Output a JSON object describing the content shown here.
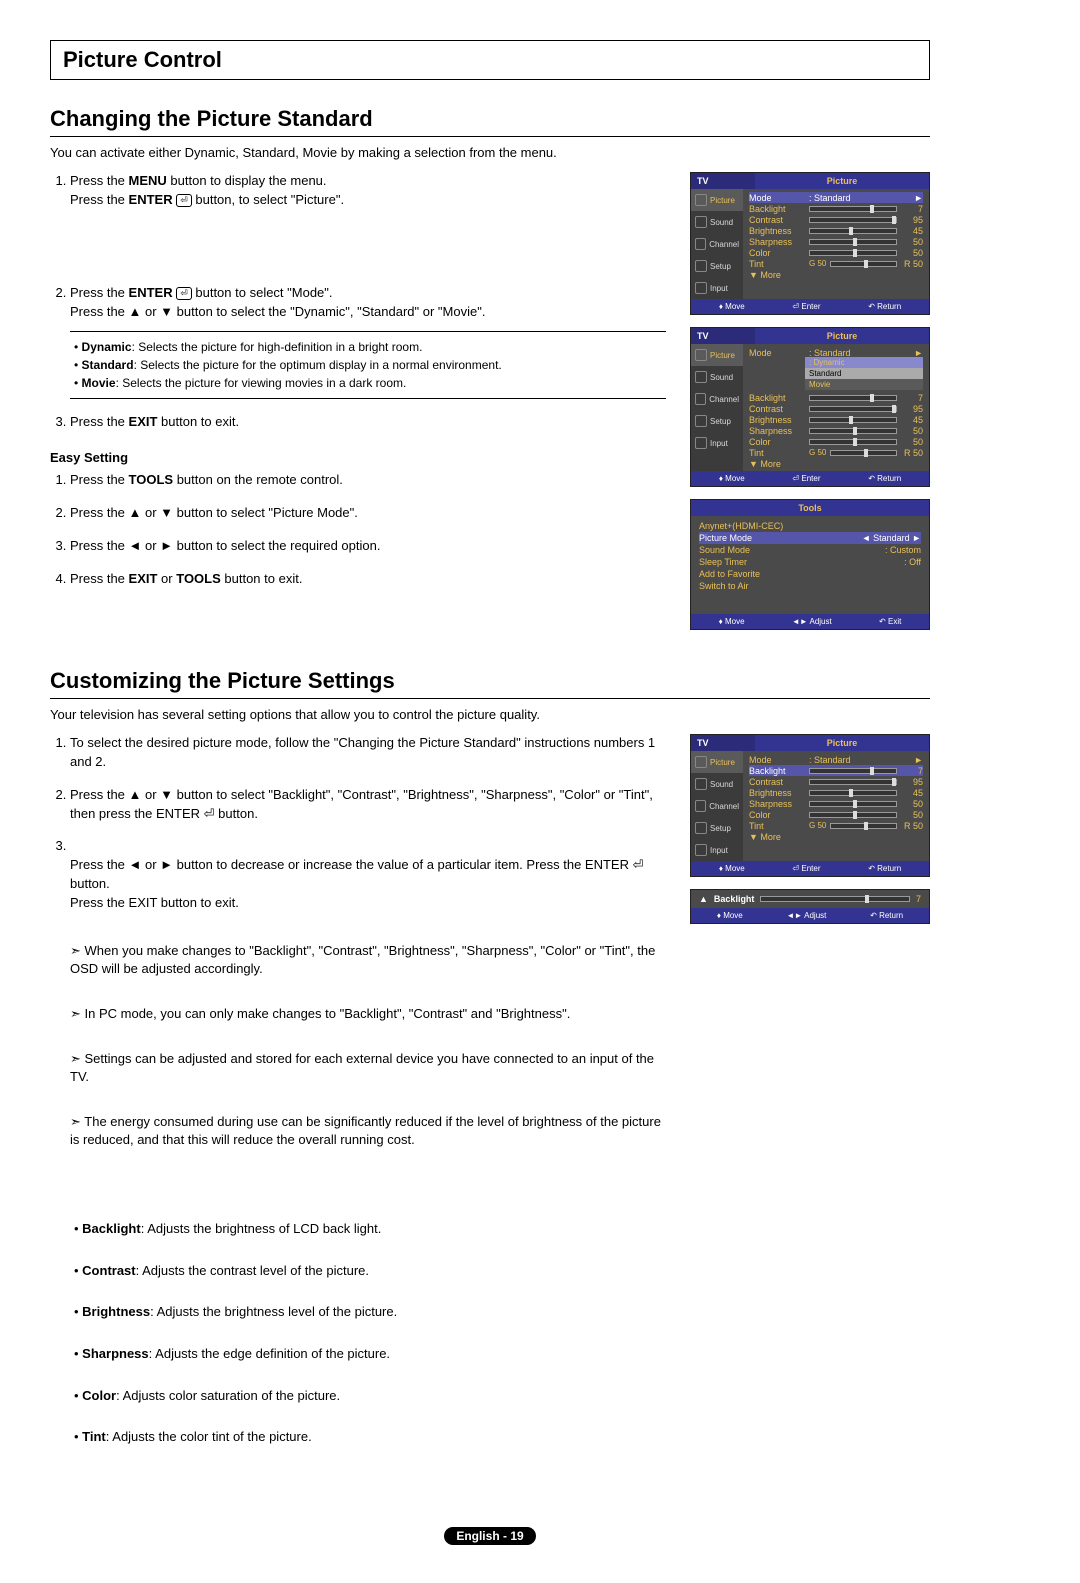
{
  "section_title": "Picture Control",
  "h2a": "Changing the Picture Standard",
  "intro_a": "You can activate either Dynamic, Standard, Movie by making a selection from the menu.",
  "steps_a": [
    {
      "pre": "Press the ",
      "b1": "MENU",
      "mid": " button to display the menu.\nPress the ",
      "b2": "ENTER",
      "post": " button, to select \"Picture\"."
    },
    {
      "pre": "Press the ",
      "b1": "ENTER",
      "mid": " button to select \"Mode\".\nPress the ▲ or ▼ button to select the \"Dynamic\", \"Standard\" or \"Movie\"."
    },
    {
      "pre": "Press the ",
      "b1": "EXIT",
      "mid": " button to exit."
    }
  ],
  "mode_desc": [
    {
      "b": "Dynamic",
      "t": ": Selects the picture for high-definition in a bright room."
    },
    {
      "b": "Standard",
      "t": ": Selects the picture for the optimum display in a normal environment."
    },
    {
      "b": "Movie",
      "t": ": Selects the picture for viewing movies in a dark room."
    }
  ],
  "easy_heading": "Easy Setting",
  "easy_steps": [
    {
      "pre": "Press the ",
      "b": "TOOLS",
      "post": " button on the remote control."
    },
    {
      "pre": "Press the ▲ or ▼ button to select \"Picture Mode\"."
    },
    {
      "pre": "Press the ◄ or ► button to select the required option."
    },
    {
      "pre": "Press the ",
      "b": "EXIT",
      "mid": " or ",
      "b2": "TOOLS",
      "post": " button to exit."
    }
  ],
  "h2b": "Customizing the Picture Settings",
  "intro_b": "Your television has several setting options that allow you to control the picture quality.",
  "steps_b": [
    "To select the desired picture mode, follow the \"Changing the Picture Standard\" instructions numbers 1 and 2.",
    "Press the ▲ or ▼ button to select \"Backlight\", \"Contrast\", \"Brightness\", \"Sharpness\", \"Color\" or \"Tint\", then press the ENTER ⏎ button.",
    "Press the ◄ or ► button to decrease or increase the value of a particular item. Press the ENTER ⏎ button.\nPress the EXIT button to exit."
  ],
  "arrow_notes": [
    "When you make changes to \"Backlight\", \"Contrast\", \"Brightness\", \"Sharpness\", \"Color\" or \"Tint\", the OSD will be adjusted accordingly.",
    "In PC mode, you can only make changes to \"Backlight\", \"Contrast\" and \"Brightness\".",
    "Settings can be adjusted and stored for each external device you have connected to an input of the TV.",
    "The energy consumed during use can be significantly reduced if the level of brightness of the picture is reduced, and that this will reduce the overall running cost."
  ],
  "setting_desc": [
    {
      "b": "Backlight",
      "t": ": Adjusts the brightness of LCD back light."
    },
    {
      "b": "Contrast",
      "t": ": Adjusts the contrast level of the picture."
    },
    {
      "b": "Brightness",
      "t": ": Adjusts the brightness level of the picture."
    },
    {
      "b": "Sharpness",
      "t": ": Adjusts the edge definition of the picture."
    },
    {
      "b": "Color",
      "t": ": Adjusts color saturation of the picture."
    },
    {
      "b": "Tint",
      "t": ": Adjusts the color tint of the picture."
    }
  ],
  "osd": {
    "tv": "TV",
    "picture": "Picture",
    "tools": "Tools",
    "side": [
      "Picture",
      "Sound",
      "Channel",
      "Setup",
      "Input"
    ],
    "rows": [
      {
        "label": "Mode",
        "rval": ": Standard",
        "type": "arrow"
      },
      {
        "label": "Backlight",
        "val": "7",
        "knob": 70
      },
      {
        "label": "Contrast",
        "val": "95",
        "knob": 95
      },
      {
        "label": "Brightness",
        "val": "45",
        "knob": 45
      },
      {
        "label": "Sharpness",
        "val": "50",
        "knob": 50
      },
      {
        "label": "Color",
        "val": "50",
        "knob": 50
      },
      {
        "label": "Tint",
        "pre": "G 50",
        "val": "R 50",
        "knob": 50
      },
      {
        "label": "▼ More"
      }
    ],
    "mode_opts": [
      "Dynamic",
      "Standard",
      "Movie"
    ],
    "footer": {
      "move": "Move",
      "enter": "Enter",
      "return": "Return",
      "adjust": "Adjust",
      "exit": "Exit"
    },
    "tools_rows": [
      {
        "l": "Anynet+(HDMI-CEC)",
        "r": ""
      },
      {
        "l": "Picture Mode",
        "r": "◄  Standard  ►",
        "sel": true
      },
      {
        "l": "Sound Mode",
        "r": ":      Custom"
      },
      {
        "l": "Sleep Timer",
        "r": ":          Off"
      },
      {
        "l": "Add to Favorite",
        "r": ""
      },
      {
        "l": "Switch to Air",
        "r": ""
      }
    ],
    "adjust_row": {
      "label": "Backlight",
      "val": "7",
      "knob": 70
    }
  },
  "footer": {
    "lang": "English - ",
    "page": "19"
  }
}
